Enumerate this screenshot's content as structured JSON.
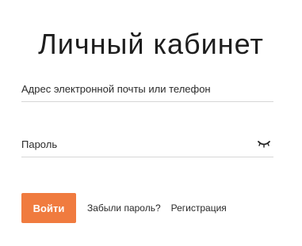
{
  "page": {
    "title": "Личный кабинет"
  },
  "form": {
    "email_placeholder": "Адрес электронной почты или телефон",
    "password_placeholder": "Пароль",
    "toggle_password_icon": "eye-closed-icon",
    "submit_label": "Войти",
    "forgot_password_label": "Забыли пароль?",
    "register_label": "Регистрация"
  },
  "colors": {
    "accent": "#f07b3f",
    "button_text": "#ffffff",
    "text": "#222222",
    "underline": "#d6d6d6"
  }
}
